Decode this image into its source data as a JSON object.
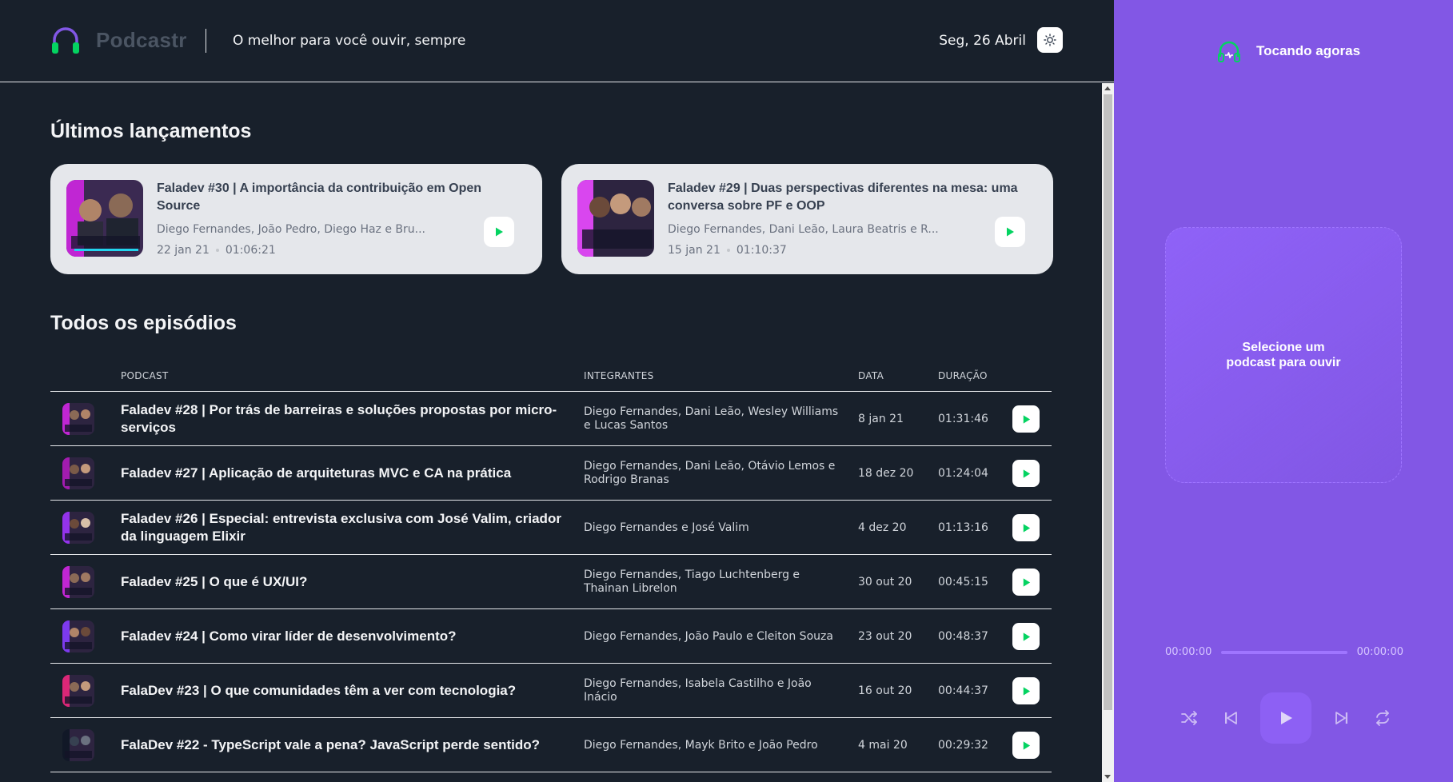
{
  "header": {
    "app_name": "Podcastr",
    "tagline": "O melhor para você ouvir, sempre",
    "date": "Seg, 26 Abril",
    "icons": {
      "logo": "headphones-logo",
      "theme": "sun-icon"
    }
  },
  "latest": {
    "heading": "Últimos lançamentos",
    "episodes": [
      {
        "title": "Faladev #30 | A importância da contribuição em Open Source",
        "members": "Diego Fernandes, João Pedro, Diego Haz e Bru...",
        "date": "22 jan 21",
        "duration": "01:06:21",
        "thumb_text": "Por que é tão importante contribuir em Open Source"
      },
      {
        "title": "Faladev #29 | Duas perspectivas diferentes na mesa: uma conversa sobre PF e OOP",
        "members": "Diego Fernandes, Dani Leão, Laura Beatris e R...",
        "date": "15 jan 21",
        "duration": "01:10:37",
        "thumb_text": "Programação funcional x devs orientados a obj"
      }
    ]
  },
  "all": {
    "heading": "Todos os episódios",
    "columns": [
      "Podcast",
      "Integrantes",
      "Data",
      "Duração"
    ],
    "episodes": [
      {
        "title": "Faladev #28 | Por trás de barreiras e soluções propostas por micro-serviços",
        "members": "Diego Fernandes, Dani Leão, Wesley Williams e Lucas Santos",
        "date": "8 jan 21",
        "duration": "01:31:46"
      },
      {
        "title": "Faladev #27 | Aplicação de arquiteturas MVC e CA na prática",
        "members": "Diego Fernandes, Dani Leão, Otávio Lemos e Rodrigo Branas",
        "date": "18 dez 20",
        "duration": "01:24:04"
      },
      {
        "title": "Faladev #26 | Especial: entrevista exclusiva com José Valim, criador da linguagem Elixir",
        "members": "Diego Fernandes e José Valim",
        "date": "4 dez 20",
        "duration": "01:13:16"
      },
      {
        "title": "Faladev #25 | O que é UX/UI?",
        "members": "Diego Fernandes, Tiago Luchtenberg e Thainan Librelon",
        "date": "30 out 20",
        "duration": "00:45:15"
      },
      {
        "title": "Faladev #24 | Como virar líder de desenvolvimento?",
        "members": "Diego Fernandes, João Paulo e Cleiton Souza",
        "date": "23 out 20",
        "duration": "00:48:37"
      },
      {
        "title": "FalaDev #23 | O que comunidades têm a ver com tecnologia?",
        "members": "Diego Fernandes, Isabela Castilho e João Inácio",
        "date": "16 out 20",
        "duration": "00:44:37"
      },
      {
        "title": "FalaDev #22 - TypeScript vale a pena? JavaScript perde sentido?",
        "members": "Diego Fernandes, Mayk Brito e João Pedro",
        "date": "4 mai 20",
        "duration": "00:29:32"
      }
    ]
  },
  "player": {
    "title": "Tocando agoras",
    "empty_message": "Selecione um podcast para ouvir",
    "current_time": "00:00:00",
    "total_time": "00:00:00",
    "progress": 0,
    "icons": [
      "shuffle-icon",
      "previous-icon",
      "play-icon",
      "next-icon",
      "repeat-icon"
    ]
  },
  "colors": {
    "background": "#18202b",
    "card": "#e5e7eb",
    "player": "#8257e5",
    "accent_green": "#04d361"
  }
}
